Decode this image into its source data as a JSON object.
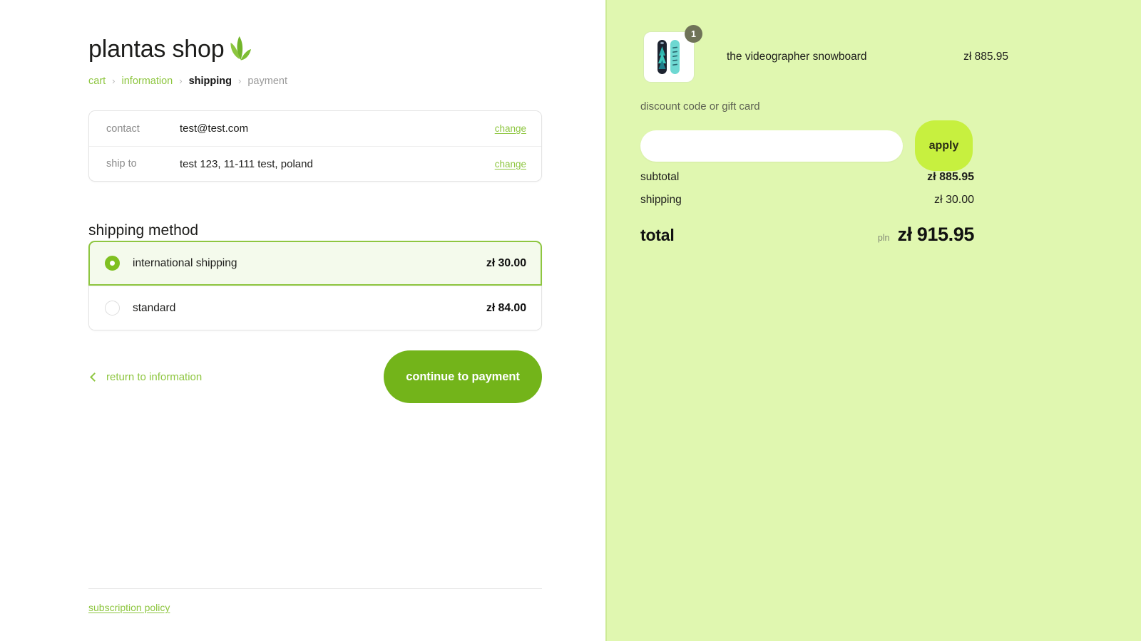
{
  "brand": {
    "name": "plantas shop",
    "logo_icon": "leaf-icon",
    "leaf_color": "#72b52a"
  },
  "breadcrumb": {
    "separator": "›",
    "items": [
      {
        "label": "cart",
        "state": "done"
      },
      {
        "label": "information",
        "state": "done"
      },
      {
        "label": "shipping",
        "state": "current"
      },
      {
        "label": "payment",
        "state": "upcoming"
      }
    ]
  },
  "info_card": {
    "rows": [
      {
        "label": "contact",
        "value": "test@test.com",
        "action": "change"
      },
      {
        "label": "ship to",
        "value": "test 123, 11-111 test, poland",
        "action": "change"
      }
    ]
  },
  "shipping": {
    "section_title": "shipping method",
    "options": [
      {
        "name": "international shipping",
        "price": "zł 30.00",
        "selected": true
      },
      {
        "name": "standard",
        "price": "zł 84.00",
        "selected": false
      }
    ]
  },
  "actions": {
    "return_label": "return to information",
    "return_icon": "chevron-left-icon",
    "continue_label": "continue to payment",
    "continue_color": "#73b41a"
  },
  "footer": {
    "link_label": "subscription policy"
  },
  "summary": {
    "item": {
      "name": "the videographer snowboard",
      "price": "zł 885.95",
      "quantity": "1",
      "thumbnail_icon": "snowboard-thumbnail"
    },
    "discount": {
      "label": "discount code or gift card",
      "value": "",
      "placeholder": "",
      "apply_label": "apply",
      "apply_color": "#c7f03f"
    },
    "lines": [
      {
        "label": "subtotal",
        "value": "zł 885.95",
        "bold": true
      },
      {
        "label": "shipping",
        "value": "zł 30.00",
        "bold": false
      }
    ],
    "total": {
      "label": "total",
      "currency": "pln",
      "value": "zł 915.95"
    },
    "panel_color": "#e0f7b0"
  }
}
